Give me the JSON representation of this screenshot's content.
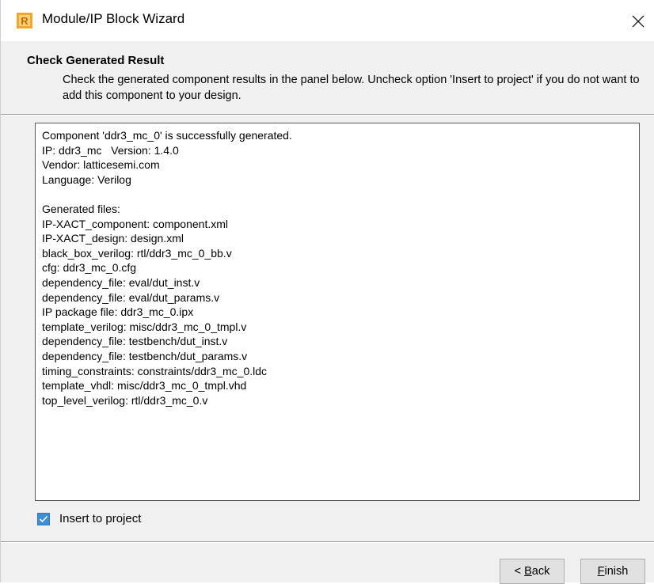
{
  "window": {
    "title": "Module/IP Block Wizard",
    "close_glyph": "✕"
  },
  "header": {
    "title": "Check Generated Result",
    "description": "Check the generated component results in the panel below. Uncheck option 'Insert to project' if you do not want to add this component to your design."
  },
  "output": {
    "lines": [
      "Component 'ddr3_mc_0' is successfully generated.",
      "IP: ddr3_mc   Version: 1.4.0",
      "Vendor: latticesemi.com",
      "Language: Verilog",
      "",
      "Generated files:",
      "IP-XACT_component: component.xml",
      "IP-XACT_design: design.xml",
      "black_box_verilog: rtl/ddr3_mc_0_bb.v",
      "cfg: ddr3_mc_0.cfg",
      "dependency_file: eval/dut_inst.v",
      "dependency_file: eval/dut_params.v",
      "IP package file: ddr3_mc_0.ipx",
      "template_verilog: misc/ddr3_mc_0_tmpl.v",
      "dependency_file: testbench/dut_inst.v",
      "dependency_file: testbench/dut_params.v",
      "timing_constraints: constraints/ddr3_mc_0.ldc",
      "template_vhdl: misc/ddr3_mc_0_tmpl.vhd",
      "top_level_verilog: rtl/ddr3_mc_0.v"
    ]
  },
  "insert_to_project": {
    "label": "Insert to project",
    "checked": true
  },
  "buttons": {
    "back_prefix": "< ",
    "back_mnemonic": "B",
    "back_rest": "ack",
    "finish_mnemonic": "F",
    "finish_rest": "inish"
  },
  "colors": {
    "accent": "#3c8fd6",
    "icon_orange": "#f5a623"
  },
  "icons": {
    "app": "lattice-radiant-icon",
    "close": "close-icon",
    "check": "check-icon"
  }
}
